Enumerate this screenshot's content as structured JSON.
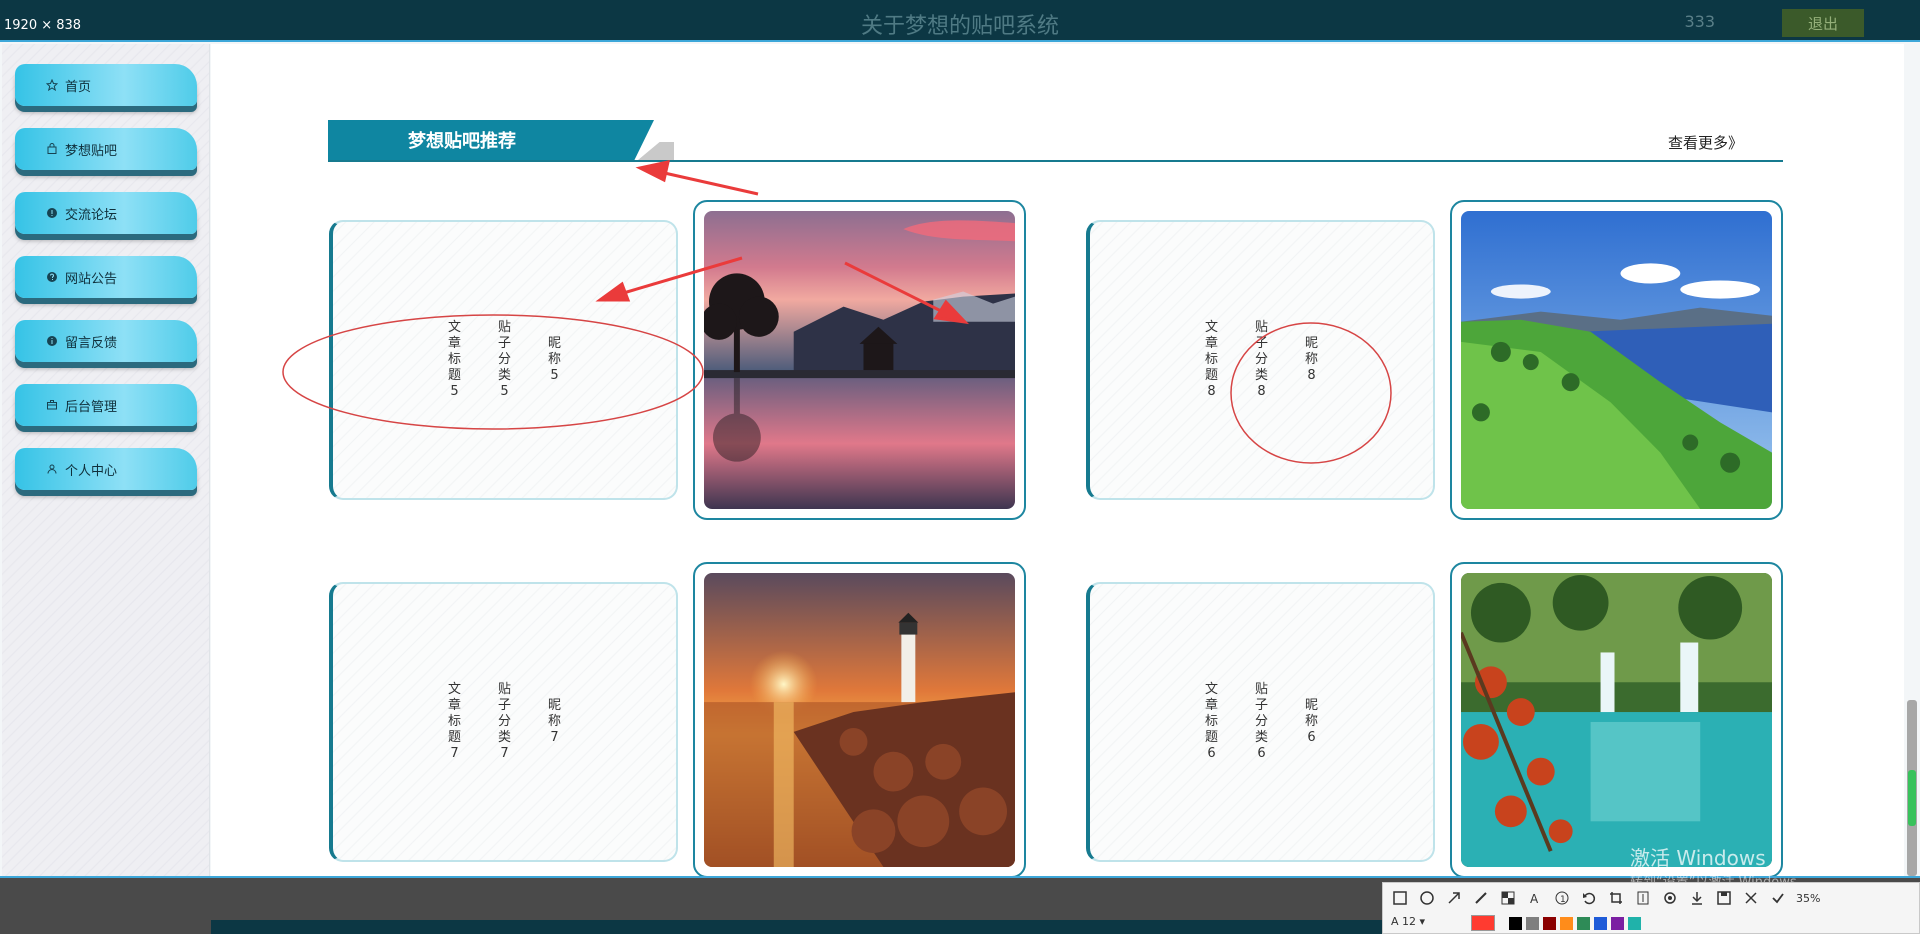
{
  "overlay": {
    "dimensions": "1920 × 838"
  },
  "header": {
    "title": "关于梦想的贴吧系统",
    "username": "333",
    "logout_label": "退出"
  },
  "sidebar": {
    "items": [
      {
        "label": "首页",
        "icon": "star-icon"
      },
      {
        "label": "梦想贴吧",
        "icon": "bag-icon"
      },
      {
        "label": "交流论坛",
        "icon": "info-circle-icon"
      },
      {
        "label": "网站公告",
        "icon": "question-circle-icon"
      },
      {
        "label": "留言反馈",
        "icon": "info-circle-icon"
      },
      {
        "label": "后台管理",
        "icon": "briefcase-icon"
      },
      {
        "label": "个人中心",
        "icon": "user-icon"
      }
    ]
  },
  "section": {
    "title": "梦想贴吧推荐",
    "more_label": "查看更多》"
  },
  "cards": [
    {
      "title": "文章标题5",
      "category": "贴子分类5",
      "nickname": "昵称5",
      "image": "sunset-lake-mountains"
    },
    {
      "title": "文章标题8",
      "category": "贴子分类8",
      "nickname": "昵称8",
      "image": "green-hills-lake"
    },
    {
      "title": "文章标题7",
      "category": "贴子分类7",
      "nickname": "昵称7",
      "image": "lighthouse-sunset"
    },
    {
      "title": "文章标题6",
      "category": "贴子分类6",
      "nickname": "昵称6",
      "image": "waterfall-autumn"
    }
  ],
  "watermark": {
    "line1": "激活 Windows",
    "line2": "转到“设置”以激活 Windows。"
  },
  "toolbar": {
    "zoom": "35%",
    "font_size": "12",
    "colors": [
      "#ff3b30",
      "#000000",
      "#7f7f7f",
      "#8b0000",
      "#ff8c1a",
      "#2e8b57",
      "#1e5bd8",
      "#7b1fa2",
      "#20b2aa"
    ]
  }
}
